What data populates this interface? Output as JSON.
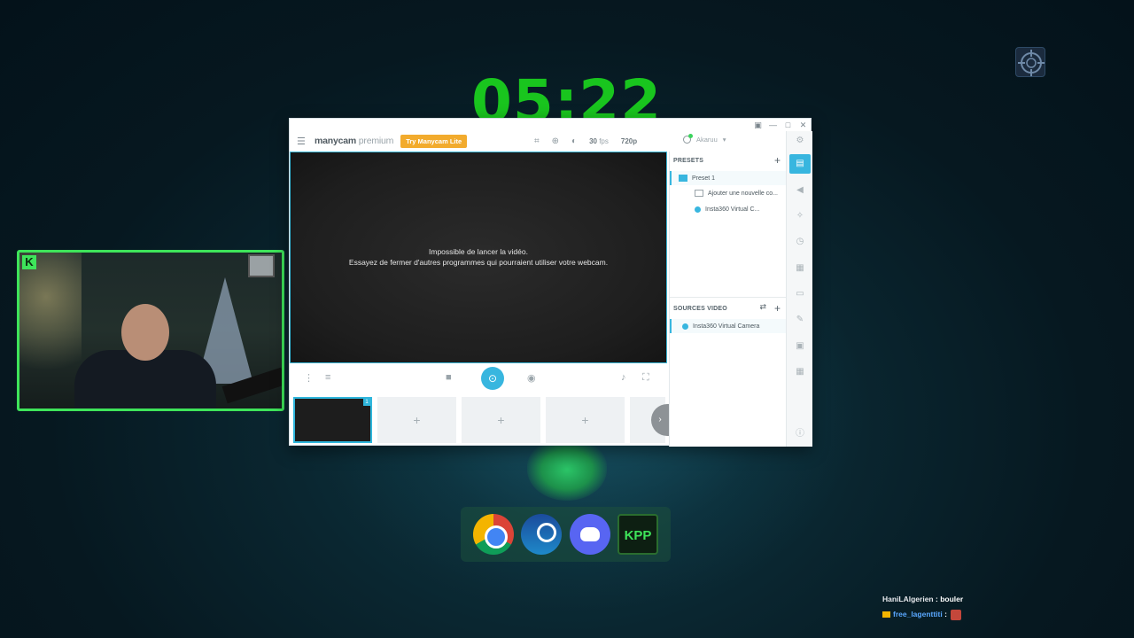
{
  "overlay": {
    "clock": "05:22"
  },
  "manycam": {
    "logo_main": "manycam",
    "logo_suffix": " premium",
    "try_button": "Try Manycam Lite",
    "fps_value": "30",
    "fps_unit": " fps",
    "resolution": "720p",
    "account": "Akaruu",
    "error_line1": "Impossible de lancer la vidéo.",
    "error_line2": "Essayez de fermer d'autres programmes qui pourraient utiliser votre webcam.",
    "presets_header": "PRESETS",
    "preset_name": "Preset 1",
    "preset_add_source": "Ajouter une nouvelle co...",
    "preset_source": "Insta360 Virtual C...",
    "sources_header": "SOURCES VIDEO",
    "source_item": "Insta360 Virtual Camera",
    "thumb_badge": "1",
    "thumb_add": "+"
  },
  "dock": {
    "apps": [
      "chrome-icon",
      "steam-icon",
      "discord-icon",
      "kpp-icon"
    ],
    "kpp_label": "KPP"
  },
  "chat": {
    "messages": [
      {
        "user": "HaniLAlgerien",
        "text": "bouler"
      },
      {
        "user": "free_lagenttiti",
        "text": ""
      }
    ]
  },
  "colors": {
    "clock": "#19c51e",
    "accent": "#38b6df",
    "try_button": "#f2ab2d",
    "webcam_border": "#3ee45a"
  }
}
